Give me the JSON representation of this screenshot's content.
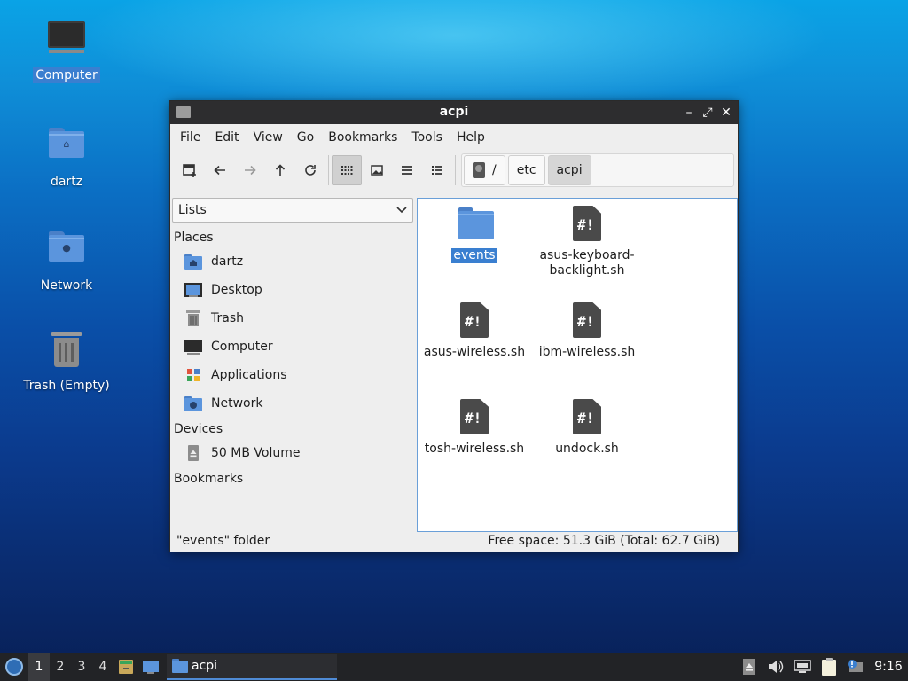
{
  "desktop": {
    "icons": [
      {
        "label": "Computer",
        "icon": "computer-icon"
      },
      {
        "label": "dartz",
        "icon": "home-folder-icon"
      },
      {
        "label": "Network",
        "icon": "network-folder-icon"
      },
      {
        "label": "Trash (Empty)",
        "icon": "trash-icon"
      }
    ]
  },
  "window": {
    "title": "acpi",
    "controls": {
      "minimize": "–",
      "maximize": "⤢",
      "close": "✕"
    },
    "menu": [
      "File",
      "Edit",
      "View",
      "Go",
      "Bookmarks",
      "Tools",
      "Help"
    ],
    "toolbar": [
      "new-tab-icon",
      "back-arrow-icon",
      "forward-arrow-icon",
      "up-arrow-icon",
      "reload-icon",
      "icon-view-icon",
      "thumbnail-view-icon",
      "compact-view-icon",
      "detailed-list-view-icon"
    ],
    "path": [
      "/",
      "etc",
      "acpi"
    ],
    "sidebar": {
      "mode": "Lists",
      "sections": {
        "places": "Places",
        "devices": "Devices",
        "bookmarks": "Bookmarks"
      },
      "places": [
        {
          "label": "dartz",
          "icon": "home-folder-icon"
        },
        {
          "label": "Desktop",
          "icon": "desktop-icon"
        },
        {
          "label": "Trash",
          "icon": "trash-icon"
        },
        {
          "label": "Computer",
          "icon": "computer-icon"
        },
        {
          "label": "Applications",
          "icon": "applications-icon"
        },
        {
          "label": "Network",
          "icon": "network-folder-icon"
        }
      ],
      "devices": [
        {
          "label": "50 MB Volume",
          "icon": "eject-drive-icon"
        }
      ]
    },
    "files": [
      {
        "name": "events",
        "type": "folder",
        "selected": true
      },
      {
        "name": "asus-keyboard-\nbacklight.sh",
        "type": "script"
      },
      {
        "name": "asus-wireless.sh",
        "type": "script"
      },
      {
        "name": "ibm-wireless.sh",
        "type": "script"
      },
      {
        "name": "tosh-wireless.sh",
        "type": "script"
      },
      {
        "name": "undock.sh",
        "type": "script"
      }
    ],
    "status": {
      "left": "\"events\" folder",
      "right": "Free space: 51.3 GiB (Total: 62.7 GiB)"
    }
  },
  "taskbar": {
    "workspaces": [
      "1",
      "2",
      "3",
      "4"
    ],
    "active_workspace": "1",
    "task": "acpi",
    "clock": "9:16"
  },
  "colors": {
    "selection": "#3a7fd0",
    "folder": "#5b95dd",
    "titlebar": "#2d2d2f",
    "taskbar": "#222326"
  }
}
